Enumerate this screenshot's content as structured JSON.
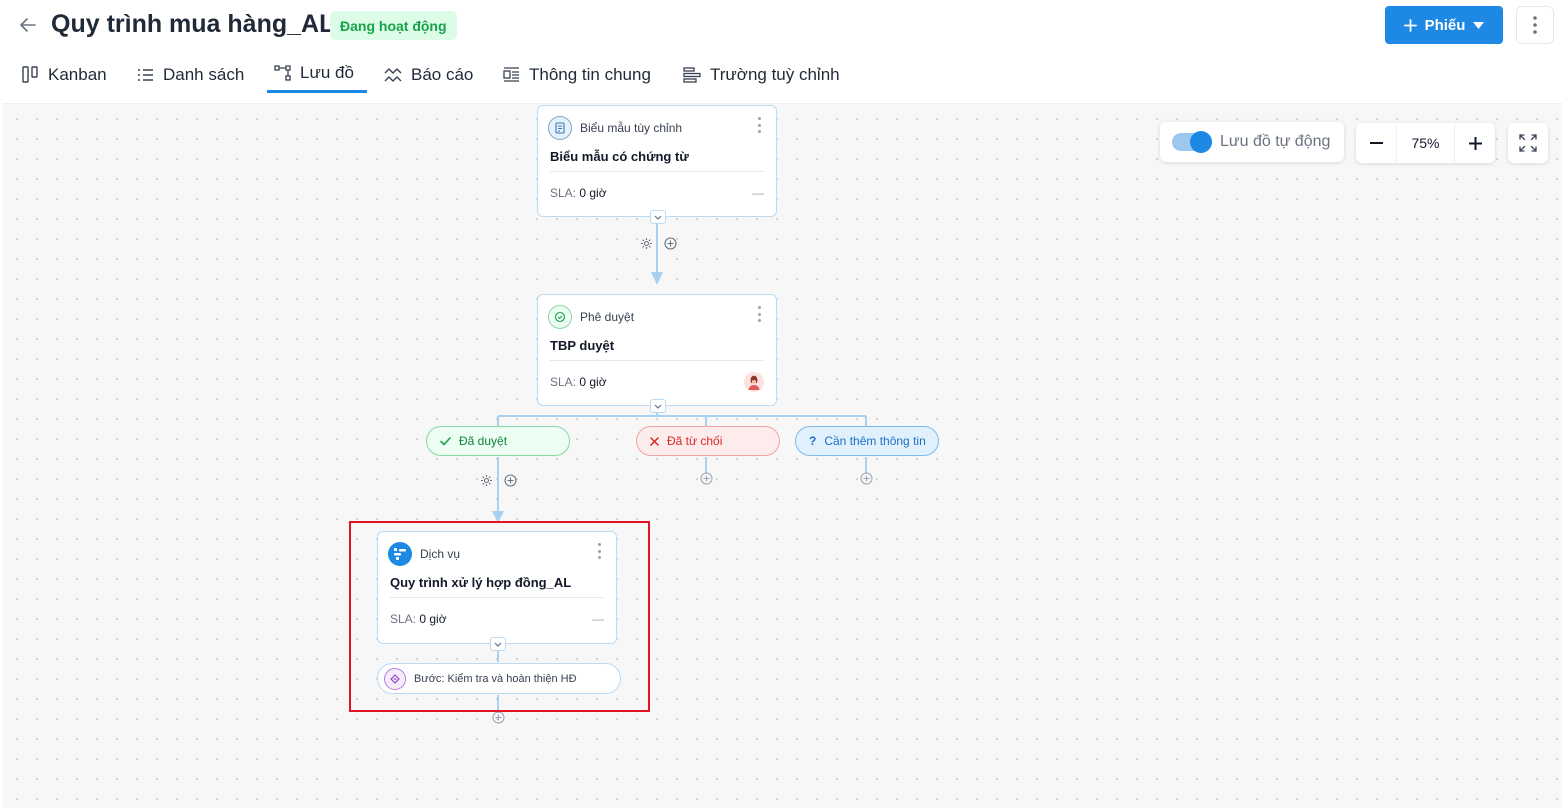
{
  "header": {
    "title": "Quy trình mua hàng_AL",
    "status": "Đang hoạt động",
    "new_button_label": "Phiếu",
    "colors": {
      "primary": "#1e88e5",
      "status_bg": "#dcfce7",
      "status_text": "#16a34a"
    }
  },
  "tabs": [
    {
      "label": "Kanban",
      "icon": "kanban-icon"
    },
    {
      "label": "Danh sách",
      "icon": "list-icon"
    },
    {
      "label": "Lưu đồ",
      "icon": "flowchart-icon",
      "active": true
    },
    {
      "label": "Báo cáo",
      "icon": "report-icon"
    },
    {
      "label": "Thông tin chung",
      "icon": "info-icon"
    },
    {
      "label": "Trường tuỳ chỉnh",
      "icon": "custom-fields-icon"
    }
  ],
  "canvas": {
    "auto_flow_label": "Lưu đồ tự động",
    "auto_flow_enabled": true,
    "zoom": "75%"
  },
  "nodes": {
    "form": {
      "type": "Biểu mẫu tùy chỉnh",
      "name": "Biểu mẫu có chứng từ",
      "sla_label": "SLA:",
      "sla_value": "0 giờ",
      "assignee": "—"
    },
    "approval": {
      "type": "Phê duyệt",
      "name": "TBP duyệt",
      "sla_label": "SLA:",
      "sla_value": "0 giờ"
    },
    "service": {
      "type": "Dịch vụ",
      "name": "Quy trình xử lý hợp đồng_AL",
      "sla_label": "SLA:",
      "sla_value": "0 giờ",
      "assignee": "—"
    }
  },
  "branches": {
    "approved": "Đã duyệt",
    "rejected": "Đã từ chối",
    "need_info": "Cần thêm thông tin"
  },
  "step": {
    "label": "Bước: Kiểm tra và hoàn thiện HĐ"
  }
}
